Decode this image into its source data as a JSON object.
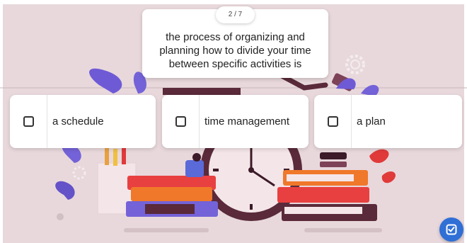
{
  "question": {
    "counter": "2 / 7",
    "text": "the process of organizing and planning how to divide your time between specific activities is"
  },
  "options": [
    {
      "label": "a schedule",
      "checked": false
    },
    {
      "label": "time management",
      "checked": false
    },
    {
      "label": "a plan",
      "checked": false
    }
  ],
  "submit_icon": "check-square-icon",
  "colors": {
    "background": "#e8d8dc",
    "accent": "#2f6fd6"
  }
}
